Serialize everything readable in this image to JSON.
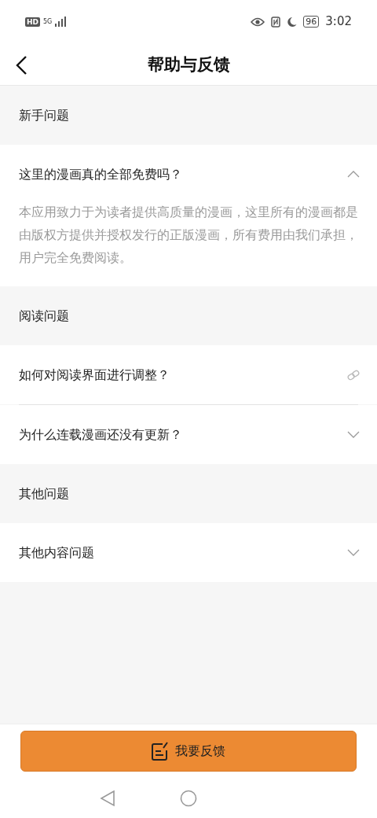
{
  "status_bar": {
    "hd": "HD",
    "network": "5G",
    "battery": "96",
    "time": "3:02"
  },
  "header": {
    "title": "帮助与反馈"
  },
  "sections": [
    {
      "title": "新手问题",
      "items": [
        {
          "kind": "toggle",
          "question": "这里的漫画真的全部免费吗？",
          "expanded": true,
          "answer": "本应用致力于为读者提供高质量的漫画，这里所有的漫画都是由版权方提供并授权发行的正版漫画，所有费用由我们承担，用户完全免费阅读。"
        }
      ]
    },
    {
      "title": "阅读问题",
      "items": [
        {
          "kind": "link",
          "question": "如何对阅读界面进行调整？"
        },
        {
          "kind": "toggle",
          "question": "为什么连载漫画还没有更新？",
          "expanded": false
        }
      ]
    },
    {
      "title": "其他问题",
      "items": [
        {
          "kind": "toggle",
          "question": "其他内容问题",
          "expanded": false
        }
      ]
    }
  ],
  "feedback_button": {
    "label": "我要反馈"
  }
}
